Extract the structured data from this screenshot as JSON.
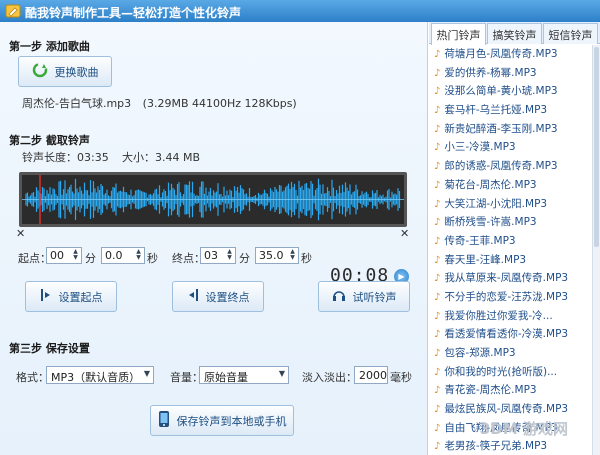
{
  "window": {
    "title": "酷我铃声制作工具—轻松打造个性化铃声",
    "icon": "wrench-icon"
  },
  "step1": {
    "title": "第一步 添加歌曲",
    "change_song_label": "更换歌曲",
    "file_name": "周杰伦-告白气球.mp3",
    "file_meta": "(3.29MB 44100Hz 128Kbps)"
  },
  "step2": {
    "title": "第二步 截取铃声",
    "ringtone_length": "铃声长度：03:35",
    "size": "大小：3.44 MB",
    "start_label": "起点：",
    "start_min": "00",
    "min_unit": "分",
    "start_sec": "0.0",
    "sec_unit": "秒",
    "end_label": "终点：",
    "end_min": "03",
    "end_sec": "35.0",
    "timer": "00:08",
    "set_start_label": "设置起点",
    "set_end_label": "设置终点",
    "preview_label": "试听铃声"
  },
  "step3": {
    "title": "第三步 保存设置",
    "format_label": "格式：",
    "format_value": "MP3（默认音质）",
    "volume_label": "音量：",
    "volume_value": "原始音量",
    "fade_label": "淡入淡出：",
    "fade_value": "2000",
    "fade_unit": "毫秒",
    "save_label": "保存铃声到本地或手机"
  },
  "sidebar": {
    "tabs": [
      "热门铃声",
      "搞笑铃声",
      "短信铃声"
    ],
    "items": [
      "荷塘月色-凤凰传奇.MP3",
      "爱的供养-杨幂.MP3",
      "没那么简单-黄小琥.MP3",
      "套马杆-乌兰托娅.MP3",
      "新贵妃醉酒-李玉刚.MP3",
      "小三-冷漠.MP3",
      "郎的诱惑-凤凰传奇.MP3",
      "菊花台-周杰伦.MP3",
      "大笑江湖-小沈阳.MP3",
      "断桥残雪-许嵩.MP3",
      "传奇-王菲.MP3",
      "春天里-汪峰.MP3",
      "我从草原来-凤凰传奇.MP3",
      "不分手的恋爱-汪苏泷.MP3",
      "我爱你胜过你爱我-冷...",
      "看透爱情看透你-冷漠.MP3",
      "包容-郑源.MP3",
      "你和我的时光(抢听版)...",
      "青花瓷-周杰伦.MP3",
      "最炫民族风-凤凰传奇.MP3",
      "自由飞翔-凤凰传奇.MP3",
      "老男孩-筷子兄弟.MP3"
    ]
  },
  "watermark": "3DM 游戏网",
  "colors": {
    "title_bar": "#2d7fc8",
    "wave": "#29a9ef",
    "wave_bg": "#2b2b2b",
    "link": "#1f4e8a"
  }
}
